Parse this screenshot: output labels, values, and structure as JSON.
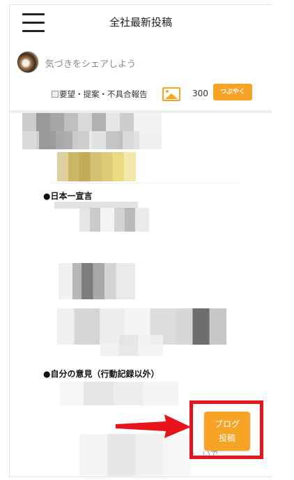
{
  "header": {
    "title": "全社最新投稿",
    "menu_icon": "hamburger-icon"
  },
  "composer": {
    "placeholder": "気づきをシェアしよう",
    "report_label": "要望・提案・不具合報告",
    "char_count": "300",
    "tweet_label": "つぶやく",
    "image_icon": "image-icon"
  },
  "feed": {
    "post1_heading": "●日本一宣言",
    "post2_heading": "●自分の意見（行動記録以外）",
    "tail_text": "いで"
  },
  "floating": {
    "blog_label_line1": "ブログ",
    "blog_label_line2": "投稿"
  },
  "colors": {
    "accent": "#f7a325",
    "highlight": "#e8141c"
  }
}
